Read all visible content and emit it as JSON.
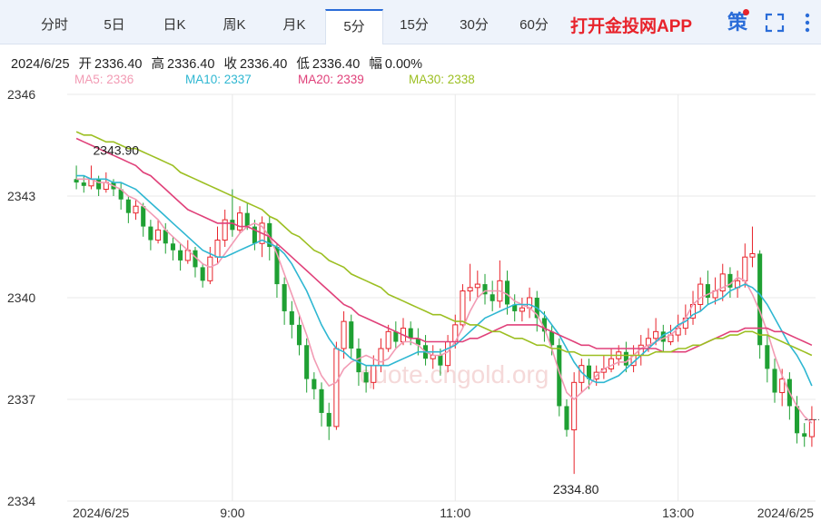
{
  "tabs": [
    {
      "label": "分时",
      "active": false
    },
    {
      "label": "5日",
      "active": false
    },
    {
      "label": "日K",
      "active": false
    },
    {
      "label": "周K",
      "active": false
    },
    {
      "label": "月K",
      "active": false
    },
    {
      "label": "5分",
      "active": true
    },
    {
      "label": "15分",
      "active": false
    },
    {
      "label": "30分",
      "active": false
    },
    {
      "label": "60分",
      "active": false
    }
  ],
  "promo_text": "打开金投网APP",
  "icons": {
    "strategy": "策",
    "fullscreen": "fullscreen-icon",
    "more": "more-vertical-icon"
  },
  "info": {
    "date": "2024/6/25",
    "open_label": "开",
    "open": "2336.40",
    "high_label": "高",
    "high": "2336.40",
    "close_label": "收",
    "close": "2336.40",
    "low_label": "低",
    "low": "2336.40",
    "change_label": "幅",
    "change": "0.00%"
  },
  "ma_legend": [
    {
      "label": "MA5: 2336",
      "color": "#f29bb4"
    },
    {
      "label": "MA10: 2337",
      "color": "#2fb7d2"
    },
    {
      "label": "MA20: 2339",
      "color": "#e0417a"
    },
    {
      "label": "MA30: 2338",
      "color": "#9cbf22"
    }
  ],
  "watermark": "quote.cngold.org",
  "colors": {
    "up": "#e8232b",
    "down": "#1fa033",
    "grid": "#e8e8e8"
  },
  "chart_data": {
    "type": "candlestick",
    "interval": "5分",
    "ylim": [
      2334,
      2346
    ],
    "y_ticks": [
      {
        "value": 2346,
        "label": "2346"
      },
      {
        "value": 2343,
        "label": "2343"
      },
      {
        "value": 2340,
        "label": "2340"
      },
      {
        "value": 2337,
        "label": "2337"
      },
      {
        "value": 2334,
        "label": "2334"
      }
    ],
    "x_ticks": [
      {
        "index": 0,
        "label": "2024/6/25",
        "align": "start"
      },
      {
        "index": 21,
        "label": "9:00",
        "align": "middle"
      },
      {
        "index": 51,
        "label": "11:00",
        "align": "middle"
      },
      {
        "index": 81,
        "label": "13:00",
        "align": "middle"
      },
      {
        "index": 99,
        "label": "2024/6/25",
        "align": "end"
      }
    ],
    "annotations": [
      {
        "index": 2,
        "value": 2343.9,
        "label": "2343.90",
        "anchor": "above"
      },
      {
        "index": 67,
        "value": 2334.8,
        "label": "2334.80",
        "anchor": "below"
      }
    ],
    "candles": [
      [
        2343.5,
        2343.4,
        2343.9,
        2343.2
      ],
      [
        2343.4,
        2343.3,
        2343.6,
        2343.1
      ],
      [
        2343.3,
        2343.5,
        2343.9,
        2343.2
      ],
      [
        2343.5,
        2343.2,
        2343.6,
        2343.0
      ],
      [
        2343.2,
        2343.4,
        2343.7,
        2343.1
      ],
      [
        2343.4,
        2343.2,
        2343.5,
        2343.0
      ],
      [
        2343.2,
        2342.9,
        2343.4,
        2342.6
      ],
      [
        2342.9,
        2342.5,
        2343.0,
        2342.2
      ],
      [
        2342.5,
        2342.7,
        2342.9,
        2342.3
      ],
      [
        2342.7,
        2342.1,
        2342.8,
        2341.8
      ],
      [
        2342.1,
        2341.7,
        2342.3,
        2341.4
      ],
      [
        2341.7,
        2342.0,
        2342.3,
        2341.6
      ],
      [
        2342.0,
        2341.6,
        2342.2,
        2341.3
      ],
      [
        2341.6,
        2341.4,
        2341.8,
        2341.1
      ],
      [
        2341.4,
        2341.1,
        2341.6,
        2340.8
      ],
      [
        2341.1,
        2341.4,
        2341.7,
        2341.0
      ],
      [
        2341.4,
        2340.9,
        2341.5,
        2340.6
      ],
      [
        2340.9,
        2340.5,
        2341.0,
        2340.3
      ],
      [
        2340.5,
        2341.2,
        2341.5,
        2340.4
      ],
      [
        2341.2,
        2341.7,
        2342.1,
        2341.0
      ],
      [
        2341.7,
        2342.3,
        2342.6,
        2341.5
      ],
      [
        2342.3,
        2342.0,
        2343.2,
        2341.8
      ],
      [
        2342.0,
        2342.5,
        2342.7,
        2341.9
      ],
      [
        2342.5,
        2342.1,
        2342.8,
        2342.0
      ],
      [
        2342.1,
        2341.6,
        2342.3,
        2341.4
      ],
      [
        2341.6,
        2342.2,
        2342.4,
        2341.2
      ],
      [
        2342.2,
        2341.5,
        2342.4,
        2341.1
      ],
      [
        2341.5,
        2340.4,
        2341.6,
        2340.0
      ],
      [
        2340.4,
        2339.6,
        2340.6,
        2339.2
      ],
      [
        2339.6,
        2339.2,
        2339.9,
        2338.8
      ],
      [
        2339.2,
        2338.6,
        2339.5,
        2338.3
      ],
      [
        2338.6,
        2337.6,
        2338.8,
        2337.2
      ],
      [
        2337.6,
        2337.3,
        2337.8,
        2337.0
      ],
      [
        2337.3,
        2336.6,
        2337.5,
        2336.2
      ],
      [
        2336.6,
        2336.2,
        2336.9,
        2335.8
      ],
      [
        2336.2,
        2338.5,
        2338.7,
        2336.1
      ],
      [
        2338.5,
        2339.3,
        2339.6,
        2338.2
      ],
      [
        2339.3,
        2338.5,
        2339.5,
        2338.2
      ],
      [
        2338.5,
        2337.8,
        2338.8,
        2337.4
      ],
      [
        2337.8,
        2337.5,
        2338.0,
        2337.2
      ],
      [
        2337.5,
        2338.0,
        2338.3,
        2337.3
      ],
      [
        2338.0,
        2338.5,
        2338.8,
        2337.8
      ],
      [
        2338.5,
        2339.0,
        2339.2,
        2338.4
      ],
      [
        2339.0,
        2338.7,
        2339.3,
        2338.5
      ],
      [
        2338.7,
        2339.1,
        2339.4,
        2338.6
      ],
      [
        2339.1,
        2338.8,
        2339.3,
        2338.6
      ],
      [
        2338.8,
        2338.6,
        2339.1,
        2338.3
      ],
      [
        2338.6,
        2338.2,
        2338.9,
        2338.0
      ],
      [
        2338.2,
        2338.3,
        2338.6,
        2337.9
      ],
      [
        2338.3,
        2338.0,
        2338.5,
        2337.7
      ],
      [
        2338.0,
        2338.7,
        2338.9,
        2337.8
      ],
      [
        2338.7,
        2339.2,
        2339.5,
        2338.5
      ],
      [
        2339.2,
        2340.2,
        2340.4,
        2339.1
      ],
      [
        2340.2,
        2340.3,
        2341.0,
        2339.9
      ],
      [
        2340.3,
        2340.4,
        2340.8,
        2340.0
      ],
      [
        2340.4,
        2340.1,
        2340.7,
        2339.8
      ],
      [
        2340.1,
        2339.9,
        2340.5,
        2339.6
      ],
      [
        2339.9,
        2340.5,
        2341.1,
        2339.7
      ],
      [
        2340.5,
        2339.8,
        2340.8,
        2339.5
      ],
      [
        2339.8,
        2339.6,
        2340.1,
        2339.3
      ],
      [
        2339.6,
        2339.7,
        2340.0,
        2339.3
      ],
      [
        2339.7,
        2340.0,
        2340.3,
        2339.4
      ],
      [
        2340.0,
        2339.4,
        2340.2,
        2339.0
      ],
      [
        2339.4,
        2339.0,
        2339.6,
        2338.7
      ],
      [
        2339.0,
        2338.6,
        2339.2,
        2338.3
      ],
      [
        2338.6,
        2336.8,
        2338.8,
        2336.5
      ],
      [
        2336.8,
        2336.1,
        2337.0,
        2335.9
      ],
      [
        2336.1,
        2337.5,
        2337.8,
        2334.8
      ],
      [
        2337.5,
        2338.0,
        2338.2,
        2337.2
      ],
      [
        2338.0,
        2337.6,
        2338.2,
        2337.3
      ],
      [
        2337.6,
        2337.8,
        2338.0,
        2337.4
      ],
      [
        2337.8,
        2337.9,
        2338.3,
        2337.6
      ],
      [
        2337.9,
        2338.2,
        2338.5,
        2337.8
      ],
      [
        2338.2,
        2338.4,
        2338.6,
        2338.0
      ],
      [
        2338.4,
        2338.0,
        2338.7,
        2337.8
      ],
      [
        2338.0,
        2338.3,
        2338.6,
        2337.8
      ],
      [
        2338.3,
        2338.6,
        2338.9,
        2338.0
      ],
      [
        2338.6,
        2338.8,
        2339.1,
        2338.4
      ],
      [
        2338.8,
        2339.0,
        2339.4,
        2338.6
      ],
      [
        2339.0,
        2338.7,
        2339.2,
        2338.4
      ],
      [
        2338.7,
        2338.9,
        2339.2,
        2338.6
      ],
      [
        2338.9,
        2339.1,
        2339.5,
        2338.7
      ],
      [
        2339.1,
        2339.4,
        2339.8,
        2338.9
      ],
      [
        2339.4,
        2339.8,
        2340.2,
        2339.2
      ],
      [
        2339.8,
        2340.4,
        2340.6,
        2339.6
      ],
      [
        2340.4,
        2340.0,
        2340.8,
        2339.8
      ],
      [
        2340.0,
        2340.2,
        2340.6,
        2339.8
      ],
      [
        2340.2,
        2340.7,
        2341.0,
        2339.9
      ],
      [
        2340.7,
        2340.3,
        2340.9,
        2340.0
      ],
      [
        2340.3,
        2340.5,
        2340.8,
        2340.0
      ],
      [
        2340.5,
        2341.2,
        2341.6,
        2340.3
      ],
      [
        2341.2,
        2341.3,
        2342.1,
        2340.9
      ],
      [
        2341.3,
        2338.6,
        2341.4,
        2338.2
      ],
      [
        2338.6,
        2337.9,
        2338.9,
        2337.5
      ],
      [
        2337.9,
        2337.2,
        2338.2,
        2336.9
      ],
      [
        2337.2,
        2337.6,
        2337.9,
        2336.8
      ],
      [
        2337.6,
        2336.8,
        2337.8,
        2336.4
      ],
      [
        2336.8,
        2336.0,
        2337.1,
        2335.7
      ],
      [
        2336.0,
        2335.9,
        2336.3,
        2335.6
      ],
      [
        2335.9,
        2336.4,
        2336.8,
        2335.6
      ]
    ],
    "ma_series": [
      {
        "name": "MA5",
        "color": "#f29bb4",
        "values": [
          2343.5,
          2343.5,
          2343.5,
          2343.4,
          2343.4,
          2343.3,
          2343.2,
          2343.0,
          2342.9,
          2342.7,
          2342.5,
          2342.3,
          2342.0,
          2341.8,
          2341.6,
          2341.4,
          2341.2,
          2341.0,
          2340.9,
          2341.0,
          2341.3,
          2341.6,
          2341.9,
          2342.1,
          2342.2,
          2342.1,
          2341.8,
          2341.3,
          2340.7,
          2340.1,
          2339.5,
          2338.9,
          2338.2,
          2337.7,
          2337.4,
          2337.5,
          2337.9,
          2338.1,
          2338.2,
          2338.3,
          2338.2,
          2338.1,
          2338.2,
          2338.5,
          2338.7,
          2338.7,
          2338.6,
          2338.4,
          2338.3,
          2338.3,
          2338.4,
          2338.7,
          2339.1,
          2339.6,
          2340.0,
          2340.2,
          2340.2,
          2340.2,
          2340.1,
          2339.9,
          2339.8,
          2339.7,
          2339.5,
          2339.1,
          2338.5,
          2337.8,
          2337.2,
          2337.0,
          2337.2,
          2337.4,
          2337.7,
          2337.9,
          2338.0,
          2338.1,
          2338.1,
          2338.3,
          2338.5,
          2338.6,
          2338.7,
          2338.8,
          2338.9,
          2339.1,
          2339.4,
          2339.8,
          2340.0,
          2340.1,
          2340.2,
          2340.3,
          2340.4,
          2340.6,
          2340.5,
          2340.1,
          2339.6,
          2339.0,
          2338.3,
          2337.7,
          2337.2,
          2336.8,
          2336.5,
          2336.3
        ]
      },
      {
        "name": "MA10",
        "color": "#2fb7d2",
        "values": [
          2343.6,
          2343.6,
          2343.5,
          2343.5,
          2343.5,
          2343.4,
          2343.4,
          2343.3,
          2343.2,
          2343.0,
          2342.8,
          2342.6,
          2342.4,
          2342.2,
          2342.0,
          2341.8,
          2341.6,
          2341.4,
          2341.3,
          2341.2,
          2341.2,
          2341.3,
          2341.4,
          2341.5,
          2341.6,
          2341.7,
          2341.6,
          2341.5,
          2341.3,
          2341.0,
          2340.6,
          2340.2,
          2339.7,
          2339.2,
          2338.8,
          2338.5,
          2338.4,
          2338.2,
          2338.1,
          2338.0,
          2338.0,
          2338.0,
          2338.0,
          2338.1,
          2338.2,
          2338.3,
          2338.4,
          2338.4,
          2338.4,
          2338.4,
          2338.5,
          2338.6,
          2338.8,
          2339.0,
          2339.2,
          2339.4,
          2339.5,
          2339.6,
          2339.7,
          2339.8,
          2339.8,
          2339.8,
          2339.7,
          2339.5,
          2339.2,
          2338.9,
          2338.5,
          2338.1,
          2337.8,
          2337.6,
          2337.5,
          2337.5,
          2337.6,
          2337.7,
          2337.9,
          2338.1,
          2338.3,
          2338.5,
          2338.7,
          2338.9,
          2339.0,
          2339.2,
          2339.3,
          2339.5,
          2339.6,
          2339.8,
          2339.9,
          2340.0,
          2340.2,
          2340.3,
          2340.4,
          2340.3,
          2340.1,
          2339.8,
          2339.4,
          2339.0,
          2338.6,
          2338.3,
          2337.9,
          2337.4
        ]
      },
      {
        "name": "MA20",
        "color": "#e0417a",
        "values": [
          2344.7,
          2344.6,
          2344.5,
          2344.4,
          2344.3,
          2344.2,
          2344.1,
          2344.0,
          2343.9,
          2343.7,
          2343.6,
          2343.4,
          2343.2,
          2343.0,
          2342.8,
          2342.6,
          2342.5,
          2342.4,
          2342.3,
          2342.2,
          2342.2,
          2342.2,
          2342.1,
          2342.1,
          2342.0,
          2341.9,
          2341.8,
          2341.6,
          2341.4,
          2341.2,
          2341.0,
          2340.8,
          2340.6,
          2340.4,
          2340.2,
          2340.0,
          2339.8,
          2339.7,
          2339.5,
          2339.4,
          2339.3,
          2339.2,
          2339.1,
          2339.0,
          2338.9,
          2338.8,
          2338.8,
          2338.7,
          2338.7,
          2338.7,
          2338.7,
          2338.7,
          2338.7,
          2338.8,
          2338.8,
          2338.9,
          2339.0,
          2339.1,
          2339.2,
          2339.2,
          2339.2,
          2339.2,
          2339.2,
          2339.1,
          2339.0,
          2338.9,
          2338.8,
          2338.7,
          2338.6,
          2338.6,
          2338.5,
          2338.5,
          2338.5,
          2338.5,
          2338.5,
          2338.5,
          2338.5,
          2338.5,
          2338.5,
          2338.4,
          2338.4,
          2338.4,
          2338.4,
          2338.5,
          2338.6,
          2338.7,
          2338.8,
          2338.9,
          2339.0,
          2339.0,
          2339.1,
          2339.1,
          2339.1,
          2339.1,
          2339.0,
          2339.0,
          2338.9,
          2338.8,
          2338.7,
          2338.6
        ]
      },
      {
        "name": "MA30",
        "color": "#9cbf22",
        "values": [
          2344.9,
          2344.8,
          2344.8,
          2344.7,
          2344.6,
          2344.6,
          2344.5,
          2344.4,
          2344.4,
          2344.3,
          2344.2,
          2344.1,
          2344.0,
          2343.9,
          2343.7,
          2343.6,
          2343.5,
          2343.4,
          2343.3,
          2343.2,
          2343.1,
          2343.0,
          2342.9,
          2342.8,
          2342.7,
          2342.6,
          2342.4,
          2342.3,
          2342.1,
          2341.9,
          2341.8,
          2341.6,
          2341.4,
          2341.3,
          2341.1,
          2341.0,
          2340.9,
          2340.7,
          2340.6,
          2340.5,
          2340.4,
          2340.3,
          2340.1,
          2340.0,
          2339.9,
          2339.8,
          2339.7,
          2339.6,
          2339.5,
          2339.5,
          2339.4,
          2339.3,
          2339.3,
          2339.2,
          2339.2,
          2339.1,
          2339.0,
          2339.0,
          2338.9,
          2338.8,
          2338.8,
          2338.7,
          2338.6,
          2338.6,
          2338.5,
          2338.5,
          2338.4,
          2338.4,
          2338.3,
          2338.3,
          2338.3,
          2338.3,
          2338.3,
          2338.3,
          2338.3,
          2338.3,
          2338.3,
          2338.3,
          2338.4,
          2338.4,
          2338.4,
          2338.5,
          2338.5,
          2338.6,
          2338.6,
          2338.7,
          2338.8,
          2338.8,
          2338.9,
          2338.9,
          2339.0,
          2339.0,
          2338.9,
          2338.9,
          2338.8,
          2338.7,
          2338.6,
          2338.5,
          2338.4,
          2338.3
        ]
      }
    ]
  }
}
